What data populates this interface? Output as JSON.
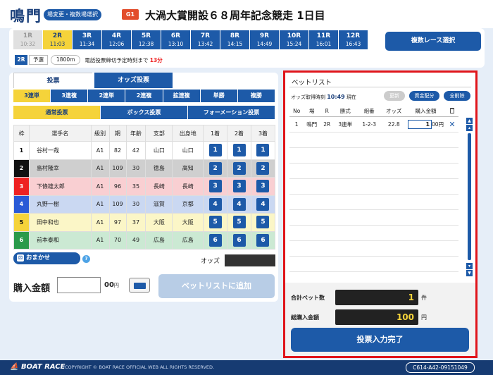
{
  "header": {
    "venue": "鳴門",
    "venue_change": "場変更・複数場選択",
    "grade": "G1",
    "title": "大渦大賞開設６８周年記念競走 1日目"
  },
  "races": [
    {
      "num": "1R",
      "time": "10:32",
      "state": "done"
    },
    {
      "num": "2R",
      "time": "11:03",
      "state": "active"
    },
    {
      "num": "3R",
      "time": "11:34",
      "state": "open"
    },
    {
      "num": "4R",
      "time": "12:06",
      "state": "open"
    },
    {
      "num": "5R",
      "time": "12:38",
      "state": "open"
    },
    {
      "num": "6R",
      "time": "13:10",
      "state": "open"
    },
    {
      "num": "7R",
      "time": "13:42",
      "state": "open"
    },
    {
      "num": "8R",
      "time": "14:15",
      "state": "open"
    },
    {
      "num": "9R",
      "time": "14:49",
      "state": "open"
    },
    {
      "num": "10R",
      "time": "15:24",
      "state": "open"
    },
    {
      "num": "11R",
      "time": "16:01",
      "state": "open"
    },
    {
      "num": "12R",
      "time": "16:43",
      "state": "open"
    }
  ],
  "multi_race_button": "複数レース選択",
  "race_info": {
    "race": "2R",
    "stage": "予選",
    "distance": "1800m",
    "deadline_text": "電話投票締切予定時刻まで",
    "deadline_value": "13分"
  },
  "tabs": {
    "vote": "投票",
    "odds": "オッズ投票"
  },
  "bet_types": [
    "3連単",
    "3連複",
    "2連単",
    "2連複",
    "拡連複",
    "単勝",
    "複勝"
  ],
  "modes": [
    "通常投票",
    "ボックス投票",
    "フォーメーション投票"
  ],
  "table": {
    "headers": [
      "枠",
      "選手名",
      "級別",
      "期",
      "年齢",
      "支部",
      "出身地",
      "1着",
      "2着",
      "3着"
    ],
    "rows": [
      {
        "frame": "1",
        "name": "谷村一哉",
        "class": "A1",
        "term": "82",
        "age": "42",
        "branch": "山口",
        "home": "山口",
        "s1": "1",
        "s2": "1",
        "s3": "1"
      },
      {
        "frame": "2",
        "name": "島村隆幸",
        "class": "A1",
        "term": "109",
        "age": "30",
        "branch": "徳島",
        "home": "高知",
        "s1": "2",
        "s2": "2",
        "s3": "2"
      },
      {
        "frame": "3",
        "name": "下條雄太郎",
        "class": "A1",
        "term": "96",
        "age": "35",
        "branch": "長崎",
        "home": "長崎",
        "s1": "3",
        "s2": "3",
        "s3": "3"
      },
      {
        "frame": "4",
        "name": "丸野一樹",
        "class": "A1",
        "term": "109",
        "age": "30",
        "branch": "滋賀",
        "home": "京都",
        "s1": "4",
        "s2": "4",
        "s3": "4"
      },
      {
        "frame": "5",
        "name": "田中和也",
        "class": "A1",
        "term": "97",
        "age": "37",
        "branch": "大阪",
        "home": "大阪",
        "s1": "5",
        "s2": "5",
        "s3": "5"
      },
      {
        "frame": "6",
        "name": "前本泰和",
        "class": "A1",
        "term": "70",
        "age": "49",
        "branch": "広島",
        "home": "広島",
        "s1": "6",
        "s2": "6",
        "s3": "6"
      }
    ]
  },
  "omakase": "おまかせ",
  "help": "?",
  "odds_label": "オッズ",
  "purchase": {
    "label": "購入金額",
    "unit": "00",
    "yen": "円",
    "add_button": "ベットリストに追加"
  },
  "betlist": {
    "title": "ベットリスト",
    "odds_time_label": "オッズ取得時刻",
    "odds_time": "10:49",
    "odds_time_suffix": "現在",
    "update": "更新",
    "alloc": "資金配分",
    "delete_all": "全削除",
    "headers": [
      "No",
      "場",
      "R",
      "勝式",
      "組番",
      "オッズ",
      "購入金額"
    ],
    "rows": [
      {
        "no": "1",
        "venue": "鳴門",
        "race": "2R",
        "type": "3連単",
        "combo": "1-2-3",
        "odds": "22.8",
        "amount": "1",
        "unit": "00円"
      }
    ],
    "total_bets_label": "合計ベット数",
    "total_bets": "1",
    "total_bets_unit": "件",
    "total_amount_label": "総購入金額",
    "total_amount": "100",
    "total_amount_unit": "円",
    "complete_button": "投票入力完了"
  },
  "footer": {
    "logo": "BOAT RACE",
    "copyright": "COPYRIGHT © BOAT RACE OFFICIAL WEB ALL RIGHTS RESERVED.",
    "id": "C614-A42-09151049"
  }
}
